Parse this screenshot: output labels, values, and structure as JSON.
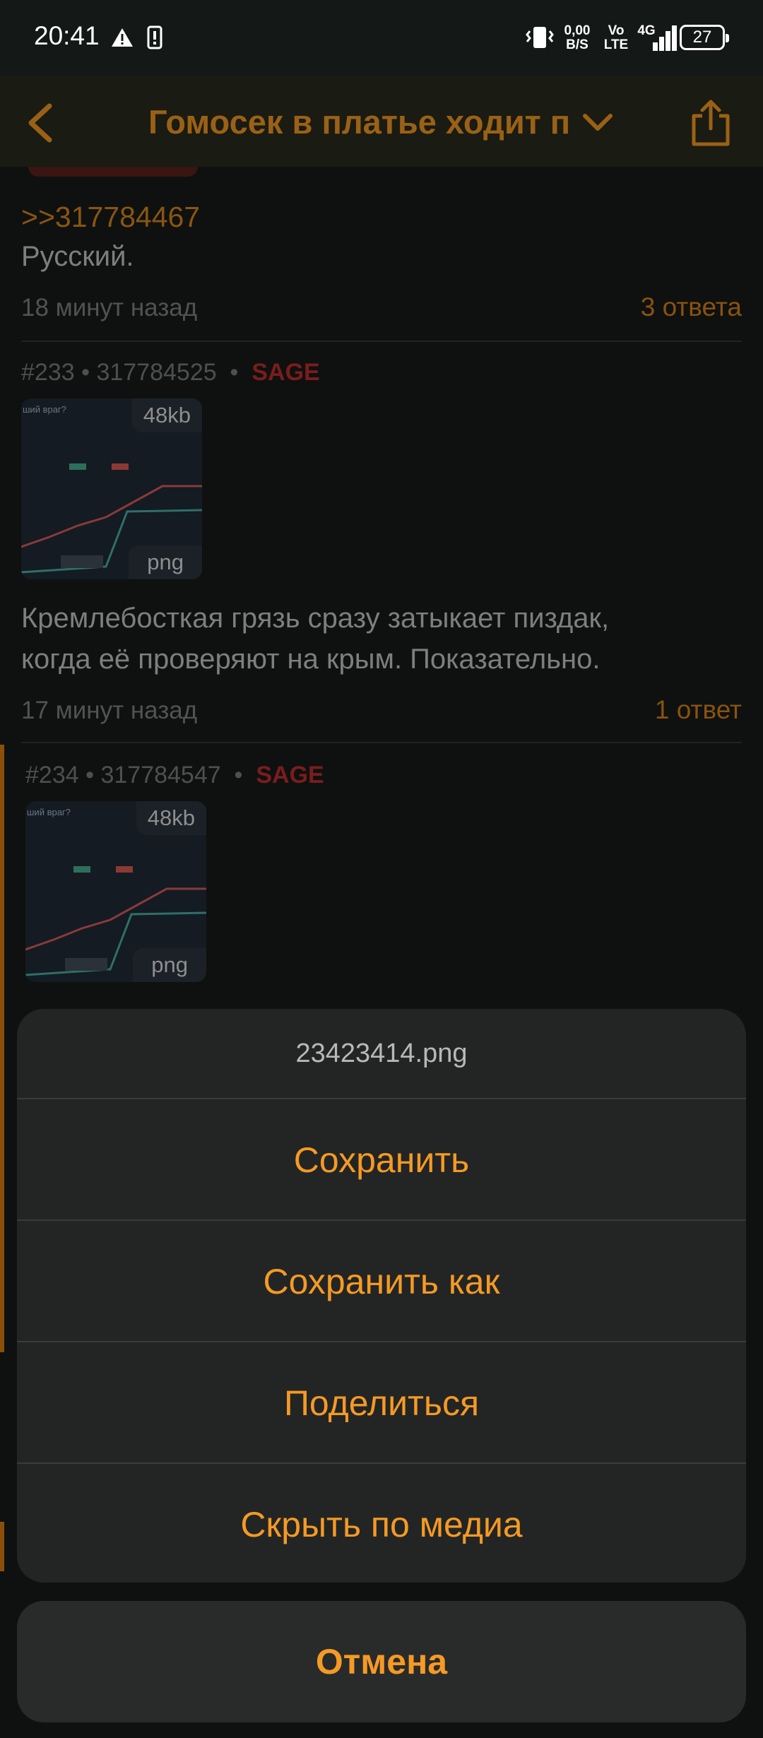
{
  "status_bar": {
    "time": "20:41",
    "net_speed_value": "0,00",
    "net_speed_unit": "B/S",
    "volte_top": "Vo",
    "volte_bottom": "LTE",
    "network": "4G",
    "battery": "27",
    "icons": [
      "warning-icon",
      "sim-icon",
      "vibrate-icon",
      "signal-icon",
      "battery-icon"
    ]
  },
  "header": {
    "title": "Гомосек в платье ходит пр",
    "icons": [
      "back-arrow-icon",
      "chevron-down-icon",
      "share-icon"
    ]
  },
  "posts": [
    {
      "reply_link": ">>317784467",
      "text": "Русский.",
      "time": "18 минут назад",
      "replies": "3 ответа"
    },
    {
      "number": "#233",
      "id": "317784525",
      "sage": "SAGE",
      "image_size": "48kb",
      "image_ext": "png",
      "text_line1": "Кремлебосткая грязь сразу затыкает пиздак,",
      "text_line2": "когда её проверяют на крым. Показательно.",
      "time": "17 минут назад",
      "replies": "1 ответ"
    },
    {
      "number": "#234",
      "id": "317784547",
      "sage": "SAGE",
      "image_size": "48kb",
      "image_ext": "png"
    }
  ],
  "separator_dot": "•",
  "sheet": {
    "title": "23423414.png",
    "items": [
      "Сохранить",
      "Сохранить как",
      "Поделиться",
      "Скрыть по медиа"
    ],
    "cancel": "Отмена"
  },
  "colors": {
    "accent": "#f59a24",
    "sage": "#b02a2a",
    "sheet_bg": "#232525"
  }
}
